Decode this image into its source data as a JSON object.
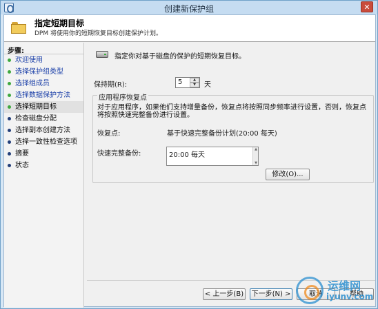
{
  "window": {
    "title": "创建新保护组",
    "close_glyph": "✕"
  },
  "header": {
    "title": "指定短期目标",
    "subtitle": "DPM 将使用你的短期恢复目标创建保护计划。"
  },
  "sidebar": {
    "heading": "步骤:",
    "items": [
      {
        "label": "欢迎使用",
        "state": "done"
      },
      {
        "label": "选择保护组类型",
        "state": "done"
      },
      {
        "label": "选择组成员",
        "state": "done"
      },
      {
        "label": "选择数据保护方法",
        "state": "done"
      },
      {
        "label": "选择短期目标",
        "state": "current"
      },
      {
        "label": "检查磁盘分配",
        "state": "pending"
      },
      {
        "label": "选择副本创建方法",
        "state": "pending"
      },
      {
        "label": "选择一致性检查选项",
        "state": "pending"
      },
      {
        "label": "摘要",
        "state": "pending"
      },
      {
        "label": "状态",
        "state": "pending"
      }
    ]
  },
  "main": {
    "description": "指定你对基于磁盘的保护的短期恢复目标。",
    "retention": {
      "label": "保持期(R):",
      "value": "5",
      "unit": "天",
      "spin_up_glyph": "▲",
      "spin_down_glyph": "▼"
    },
    "app_recovery": {
      "group_title": "应用程序恢复点",
      "description": "对于应用程序，如果他们支持增量备份，恢复点将按照同步频率进行设置，否则，恢复点将按照快速完整备份进行设置。",
      "recovery_points_label": "恢复点:",
      "recovery_points_value": "基于快速完整备份计划(20:00 每天)",
      "full_backup_label": "快速完整备份:",
      "full_backup_items": [
        "20:00 每天"
      ],
      "modify_button": "修改(O)..."
    }
  },
  "footer": {
    "prev_button": "< 上一步(B)",
    "next_button": "下一步(N) >",
    "cancel_button": "取消",
    "help_button": "帮助"
  },
  "watermark": {
    "text_cn": "运维网",
    "text_en": "iyunv.com"
  },
  "colors": {
    "frame": "#d7e7f5",
    "link_blue": "#1a3fa8",
    "step_done_dot": "#3ea83e",
    "step_pending_dot": "#233f7a",
    "watermark_blue": "#2b8fd0"
  }
}
